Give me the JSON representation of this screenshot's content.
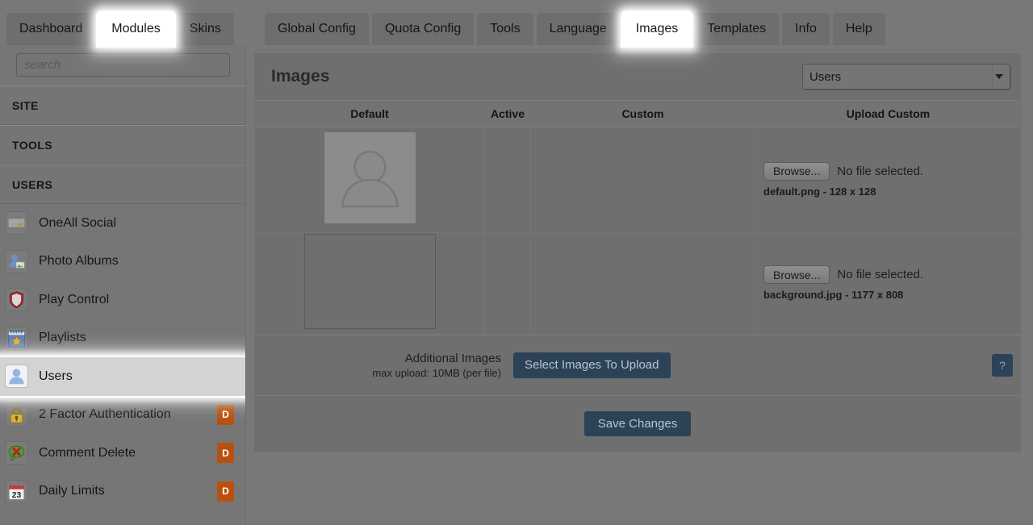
{
  "top_tabs_left": [
    {
      "label": "Dashboard",
      "active": false,
      "highlighted": false
    },
    {
      "label": "Modules",
      "active": true,
      "highlighted": true
    },
    {
      "label": "Skins",
      "active": false,
      "highlighted": false
    }
  ],
  "top_tabs_right": [
    {
      "label": "Global Config",
      "active": false,
      "highlighted": false
    },
    {
      "label": "Quota Config",
      "active": false,
      "highlighted": false
    },
    {
      "label": "Tools",
      "active": false,
      "highlighted": false
    },
    {
      "label": "Language",
      "active": false,
      "highlighted": false
    },
    {
      "label": "Images",
      "active": true,
      "highlighted": true
    },
    {
      "label": "Templates",
      "active": false,
      "highlighted": false
    },
    {
      "label": "Info",
      "active": false,
      "highlighted": false
    },
    {
      "label": "Help",
      "active": false,
      "highlighted": false
    }
  ],
  "sidebar": {
    "search": {
      "value": "",
      "placeholder": "search"
    },
    "groups": [
      {
        "label": "SITE"
      },
      {
        "label": "TOOLS"
      },
      {
        "label": "USERS"
      }
    ],
    "items": [
      {
        "label": "OneAll Social",
        "icon": "oneall-icon",
        "badge": "",
        "selected": false
      },
      {
        "label": "Photo Albums",
        "icon": "photo-albums-icon",
        "badge": "",
        "selected": false
      },
      {
        "label": "Play Control",
        "icon": "shield-icon",
        "badge": "",
        "selected": false
      },
      {
        "label": "Playlists",
        "icon": "playlist-star-icon",
        "badge": "",
        "selected": false
      },
      {
        "label": "Users",
        "icon": "user-icon",
        "badge": "",
        "selected": true
      },
      {
        "label": "2 Factor Authentication",
        "icon": "lock-icon",
        "badge": "D",
        "selected": false
      },
      {
        "label": "Comment Delete",
        "icon": "comment-delete-icon",
        "badge": "D",
        "selected": false
      },
      {
        "label": "Daily Limits",
        "icon": "calendar-icon",
        "badge": "D",
        "selected": false
      }
    ]
  },
  "main": {
    "title": "Images",
    "scope_select": {
      "value": "Users",
      "arrow_icon": "chevron-down-icon"
    },
    "table": {
      "headers": [
        "",
        "Default",
        "Active",
        "Custom",
        "Upload Custom"
      ],
      "rows": [
        {
          "thumbnail": "default-avatar-thumb",
          "active": "",
          "custom": "",
          "browse_label": "Browse...",
          "no_file_text": "No file selected.",
          "file_name": "default.png",
          "file_sep": " - ",
          "file_dims": "128 x 128"
        },
        {
          "thumbnail": "background-gradient-thumb",
          "active": "",
          "custom": "",
          "browse_label": "Browse...",
          "no_file_text": "No file selected.",
          "file_name": "background.jpg",
          "file_sep": " - ",
          "file_dims": "1177 x 808"
        }
      ]
    },
    "upload_bar": {
      "title": "Additional Images",
      "subtitle": "max upload: 10MB (per file)",
      "button_label": "Select Images To Upload",
      "help_label": "?"
    },
    "save_bar": {
      "button_label": "Save Changes"
    }
  },
  "colors": {
    "page_background": "#787878",
    "panel": "#6f6f6f",
    "sidebar": "#767676",
    "tab_inactive": "#6e6e6e",
    "tab_active": "#ffffff",
    "badge_orange": "#b8510f",
    "button_dark": "#2c4257",
    "selected_row": "#d3d3d3"
  }
}
